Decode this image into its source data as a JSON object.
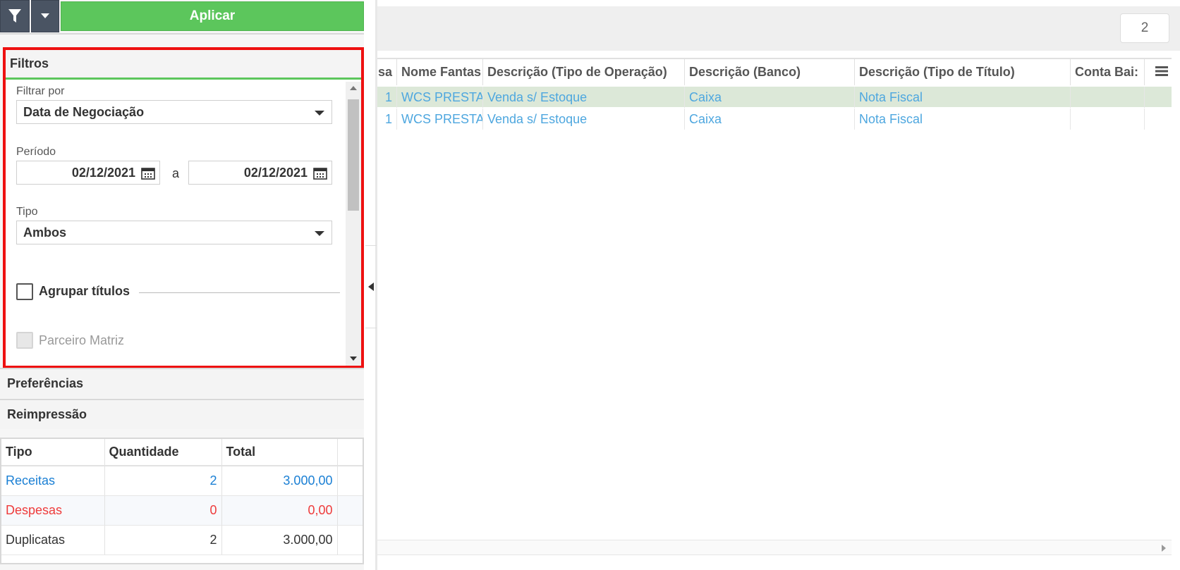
{
  "toolbar": {
    "apply_label": "Aplicar"
  },
  "filters": {
    "title": "Filtros",
    "filter_by_label": "Filtrar por",
    "filter_by_value": "Data de Negociação",
    "period_label": "Período",
    "date_from": "02/12/2021",
    "date_separator": "a",
    "date_to": "02/12/2021",
    "type_label": "Tipo",
    "type_value": "Ambos",
    "group_label": "Agrupar títulos",
    "partner_label": "Parceiro Matriz"
  },
  "sections": {
    "preferences": "Preferências",
    "reprint": "Reimpressão"
  },
  "summary": {
    "headers": [
      "Tipo",
      "Quantidade",
      "Total"
    ],
    "rows": [
      {
        "type": "Receitas",
        "qty": "2",
        "total": "3.000,00",
        "color": "#1a7fd4"
      },
      {
        "type": "Despesas",
        "qty": "0",
        "total": "0,00",
        "color": "#ee3b3b"
      },
      {
        "type": "Duplicatas",
        "qty": "2",
        "total": "3.000,00",
        "color": "#333333"
      }
    ]
  },
  "grid": {
    "page_number": "2",
    "headers": [
      "sa",
      "Nome Fantas",
      "Descrição (Tipo de Operação)",
      "Descrição (Banco)",
      "Descrição (Tipo de Título)",
      "Conta Bai:"
    ],
    "rows": [
      [
        "1",
        "WCS PRESTA",
        "Venda s/ Estoque",
        "Caixa",
        "Nota Fiscal",
        ""
      ],
      [
        "1",
        "WCS PRESTA",
        "Venda s/ Estoque",
        "Caixa",
        "Nota Fiscal",
        ""
      ]
    ],
    "selected_row_color": "#dce8d8"
  },
  "colors": {
    "accent_green": "#5cc65c",
    "highlight_red": "#ee1111",
    "link_blue": "#4ea7df"
  }
}
